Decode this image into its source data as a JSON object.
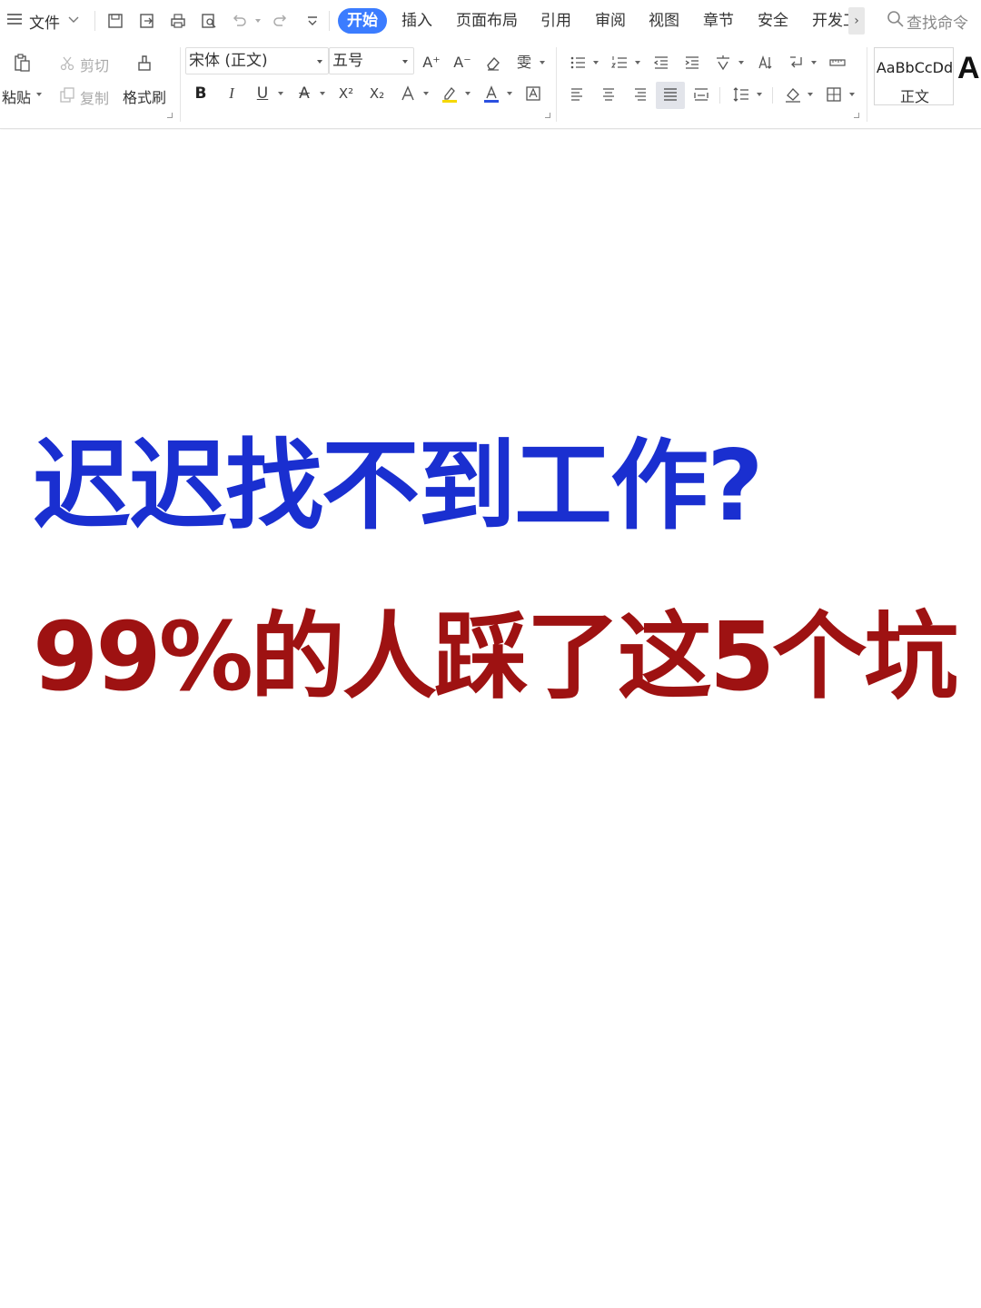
{
  "menu": {
    "file_label": "文件",
    "tabs": [
      "开始",
      "插入",
      "页面布局",
      "引用",
      "审阅",
      "视图",
      "章节",
      "安全",
      "开发工"
    ],
    "active_tab": "开始",
    "more_label": "›",
    "search_label": "查找命令"
  },
  "clipboard": {
    "paste_label": "粘贴",
    "cut_label": "剪切",
    "copy_label": "复制",
    "format_painter_label": "格式刷"
  },
  "font": {
    "family_value": "宋体 (正文)",
    "size_value": "五号",
    "bold_glyph": "B",
    "italic_glyph": "I",
    "underline_glyph": "U",
    "strike_glyph": "A",
    "superscript_glyph": "X²",
    "subscript_glyph": "X₂",
    "grow_glyph": "A⁺",
    "shrink_glyph": "A⁻",
    "pinyin_glyph": "雯"
  },
  "styles": {
    "sample_text": "AaBbCcDd",
    "style_name": "正文",
    "next_sample": "A"
  },
  "colors": {
    "active_tab": "#3b7cff",
    "headline_blue": "#1a2fd0",
    "headline_red": "#9e1212",
    "highlight_yellow": "#f5d800",
    "font_color_blue": "#2b50e0"
  },
  "document": {
    "line1": "迟迟找不到工作?",
    "line2": "99%的人踩了这5个坑"
  }
}
